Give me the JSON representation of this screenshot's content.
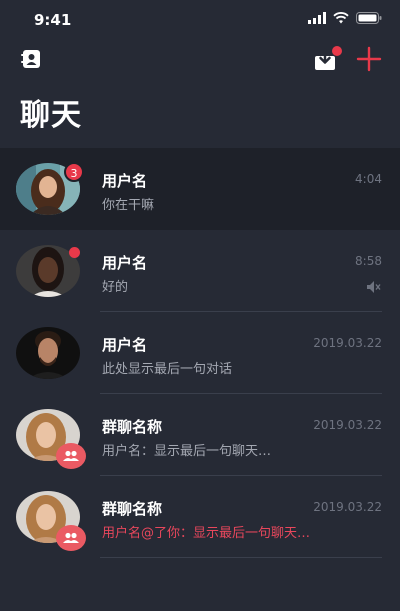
{
  "status": {
    "time": "9:41"
  },
  "header": {
    "title": "聊天"
  },
  "chats": [
    {
      "name": "用户名",
      "preview": "你在干嘛",
      "time": "4:04",
      "unread": "3"
    },
    {
      "name": "用户名",
      "preview": "好的",
      "time": "8:58"
    },
    {
      "name": "用户名",
      "preview": "此处显示最后一句对话",
      "time": "2019.03.22"
    },
    {
      "name": "群聊名称",
      "preview": "用户名：显示最后一句聊天…",
      "time": "2019.03.22"
    },
    {
      "name": "群聊名称",
      "preview": "用户名@了你：显示最后一句聊天…",
      "time": "2019.03.22"
    }
  ],
  "colors": {
    "background": "#262a35",
    "accent": "#e8394a",
    "mention": "#e8475c"
  }
}
